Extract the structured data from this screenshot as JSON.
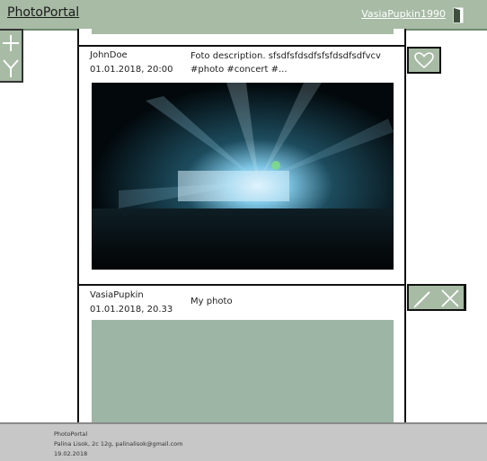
{
  "header": {
    "brand": "PhotoPortal",
    "username": "VasiaPupkin1990",
    "logout_icon": "logout-door-icon"
  },
  "side_tools": {
    "add_icon": "plus-icon",
    "filter_icon": "filter-icon"
  },
  "posts": [
    {
      "author": "JohnDoe",
      "date": "01.01.2018, 20:00",
      "description": "Foto description. sfsdfsfdsdfsfsfdsdfsdfvcv #photo #concert #...",
      "photo": "concert-photo",
      "action_icon": "heart-icon"
    },
    {
      "author": "VasiaPupkin",
      "date": "01.01.2018, 20.33",
      "description": "My photo",
      "photo": "photo-placeholder",
      "action_icons": [
        "pencil-icon",
        "close-icon"
      ]
    }
  ],
  "footer": {
    "line1": "PhotoPortal",
    "line2": "Palina Lisok, 2c 12g, palinalisok@gmail.com",
    "line3": "19.02.2018"
  },
  "colors": {
    "accent": "#a7bba5",
    "placeholder": "#9db5a4",
    "footer": "#c7c7c7"
  }
}
